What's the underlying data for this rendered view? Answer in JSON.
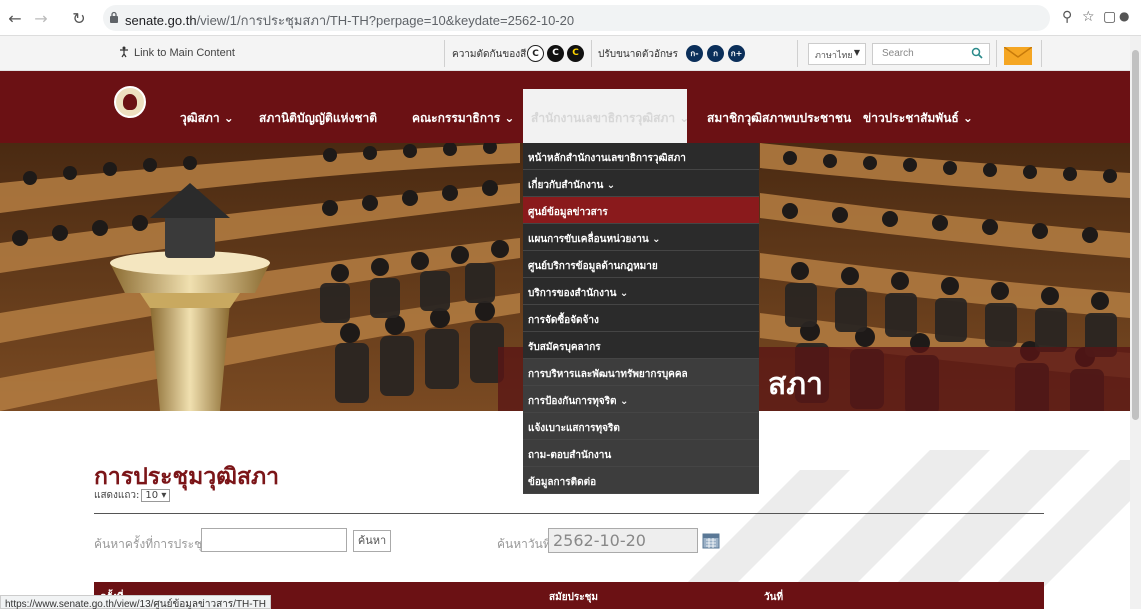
{
  "browser": {
    "url_domain": "senate.go.th",
    "url_path": "/view/1/การประชุมสภา/TH-TH?perpage=10&keydate=2562-10-20",
    "status_link": "https://www.senate.go.th/view/13/ศูนย์ข้อมูลข่าวสาร/TH-TH"
  },
  "utility": {
    "skip_link": "Link to Main Content",
    "contrast_label": "ความตัดกันของสี",
    "contrast_buttons": [
      "C",
      "C",
      "C"
    ],
    "fontsize_label": "ปรับขนาดตัวอักษร",
    "fontsize_buttons": [
      "ก-",
      "ก",
      "ก+"
    ],
    "language": "ภาษาไทย",
    "search_placeholder": "Search"
  },
  "nav": {
    "items": [
      {
        "label": "วุฒิสภา ⌄"
      },
      {
        "label": "สภานิติบัญญัติแห่งชาติ"
      },
      {
        "label": "คณะกรรมาธิการ ⌄"
      },
      {
        "label": "สำนักงานเลขาธิการวุฒิสภา ⌄"
      },
      {
        "label": "สมาชิกวุฒิสภาพบประชาชน"
      },
      {
        "label": "ข่าวประชาสัมพันธ์ ⌄"
      }
    ]
  },
  "dropdown": {
    "items": [
      {
        "label": "หน้าหลักสำนักงานเลขาธิการวุฒิสภา"
      },
      {
        "label": "เกี่ยวกับสำนักงาน ⌄"
      },
      {
        "label": "ศูนย์ข้อมูลข่าวสาร"
      },
      {
        "label": "แผนการขับเคลื่อนหน่วยงาน ⌄"
      },
      {
        "label": "ศูนย์บริการข้อมูลด้านกฎหมาย"
      },
      {
        "label": "บริการของสำนักงาน ⌄"
      },
      {
        "label": "การจัดซื้อจัดจ้าง"
      },
      {
        "label": "รับสมัครบุคลากร"
      },
      {
        "label": "การบริหารและพัฒนาทรัพยากรบุคคล"
      },
      {
        "label": "การป้องกันการทุจริต ⌄"
      },
      {
        "label": "แจ้งเบาะแสการทุจริต"
      },
      {
        "label": "ถาม-ตอบสำนักงาน"
      },
      {
        "label": "ข้อมูลการติดต่อ"
      }
    ]
  },
  "banner": {
    "title_fragment": "สภา"
  },
  "content": {
    "heading": "การประชุมวุฒิสภา",
    "perpage_label": "แสดงแถว:",
    "perpage_value": "10 ▾",
    "search_label": "ค้นหาครั้งที่การประชุม:",
    "search_button": "ค้นหา",
    "date_label": "ค้นหาวันที่:",
    "date_value": "2562-10-20",
    "table_headers": [
      "ครั้งที่",
      "สมัยประชุม",
      "วันที่"
    ]
  }
}
